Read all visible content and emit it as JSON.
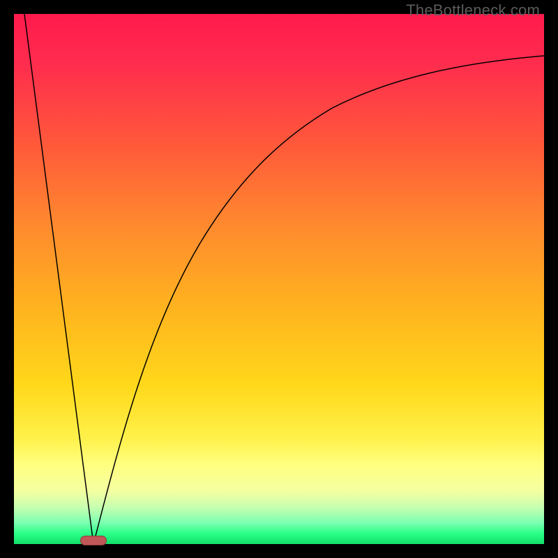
{
  "watermark": {
    "text": "TheBottleneck.com"
  },
  "colors": {
    "frame": "#000000",
    "gradient_top": "#ff1a4d",
    "gradient_mid": "#ffd81a",
    "gradient_bottom": "#12e06a",
    "curve": "#000000",
    "marker_fill": "#c05858",
    "marker_border": "#8a3a3a"
  },
  "chart_data": {
    "type": "line",
    "title": "",
    "xlabel": "",
    "ylabel": "",
    "xlim": [
      0,
      100
    ],
    "ylim": [
      0,
      100
    ],
    "annotations": [
      {
        "text": "TheBottleneck.com",
        "position": "top-right"
      }
    ],
    "series": [
      {
        "name": "left-branch",
        "shape": "line",
        "x": [
          2,
          15
        ],
        "values": [
          100,
          0
        ]
      },
      {
        "name": "right-branch",
        "shape": "curve-asymptotic",
        "x": [
          15,
          20,
          25,
          30,
          35,
          40,
          50,
          60,
          70,
          80,
          90,
          100
        ],
        "values": [
          0,
          19,
          36,
          50,
          60,
          67,
          77,
          83,
          86,
          89,
          91,
          92
        ]
      }
    ],
    "marker": {
      "x": 15,
      "y": 0,
      "shape": "pill"
    },
    "background": {
      "type": "vertical-gradient",
      "stops": [
        {
          "pos": 0,
          "color": "#ff1a4d"
        },
        {
          "pos": 25,
          "color": "#ff5a3a"
        },
        {
          "pos": 55,
          "color": "#ffb21f"
        },
        {
          "pos": 80,
          "color": "#fff14a"
        },
        {
          "pos": 96,
          "color": "#7bffb0"
        },
        {
          "pos": 100,
          "color": "#12e06a"
        }
      ]
    }
  }
}
